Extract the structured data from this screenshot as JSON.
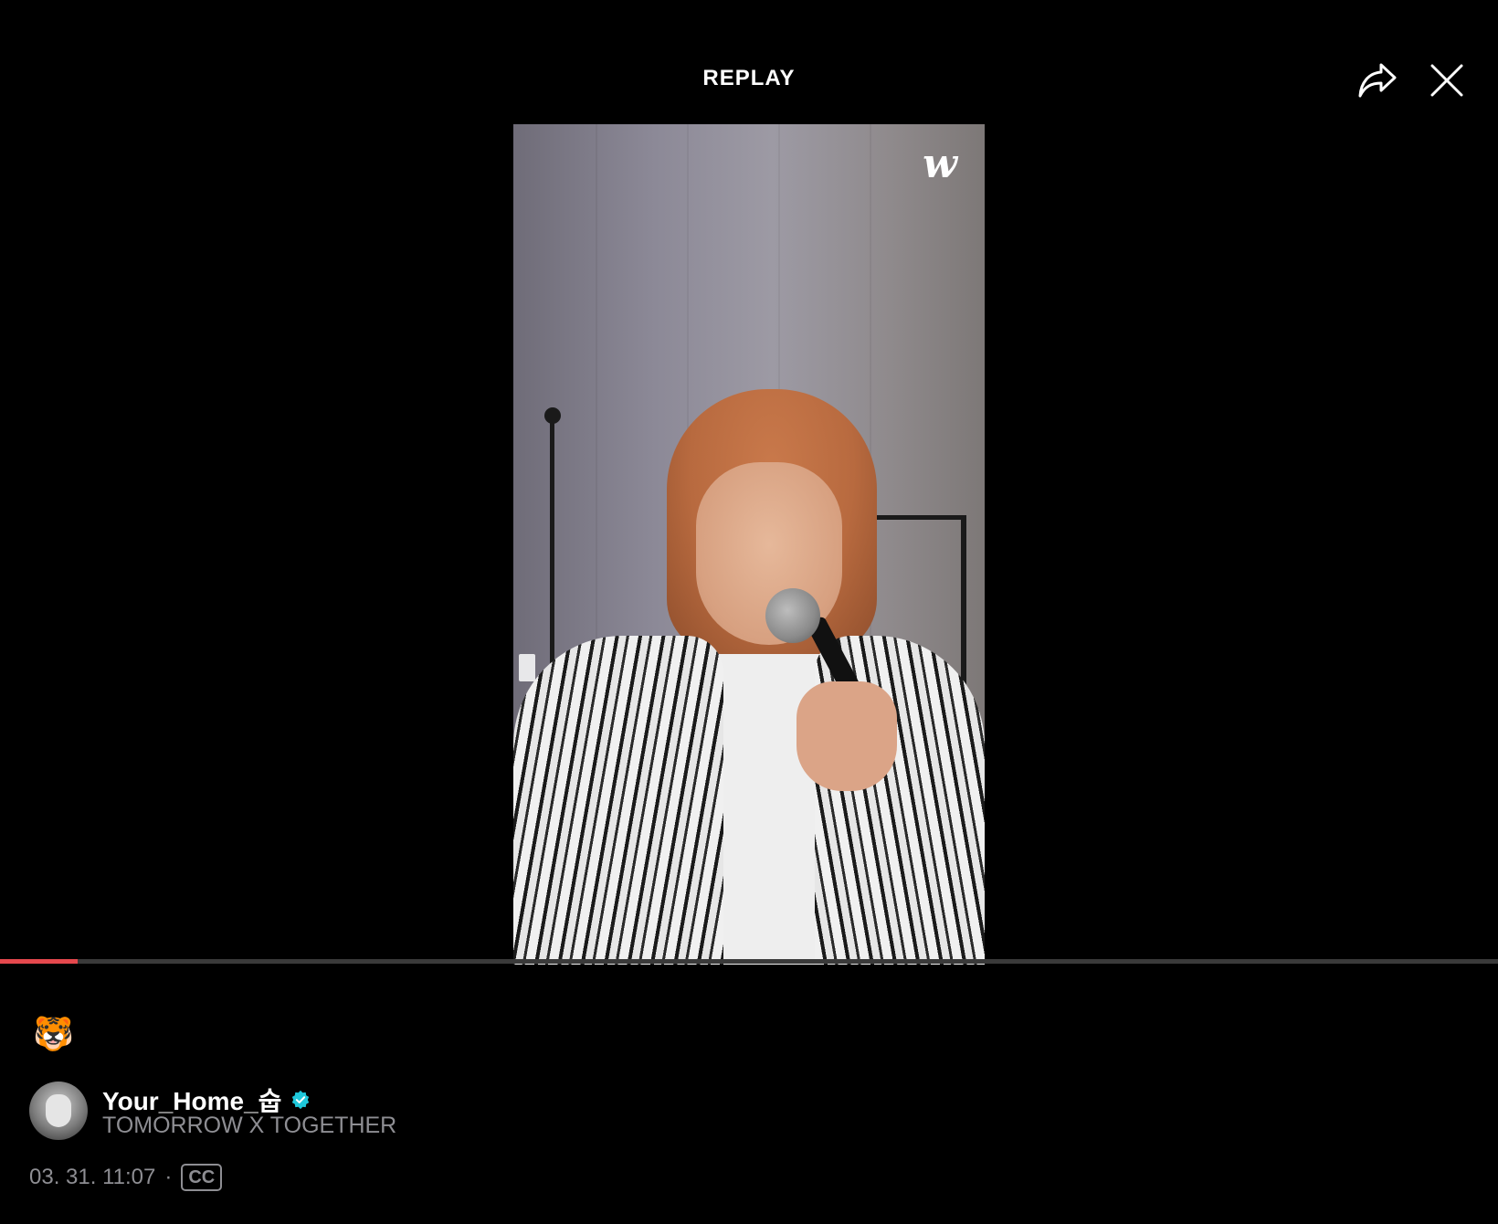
{
  "header": {
    "title": "REPLAY",
    "share_icon": "share-arrow-icon",
    "close_icon": "close-icon"
  },
  "video": {
    "watermark": "w",
    "progress_fraction": 0.052,
    "progress_color": "#e5484d"
  },
  "post": {
    "emoji": "🐯",
    "username": "Your_Home_숩",
    "verified_icon": "verified-badge-icon",
    "verified_color": "#1fc8db",
    "group": "TOMORROW X TOGETHER",
    "date": "03. 31. 11:07",
    "separator": "·",
    "cc_label": "CC"
  }
}
